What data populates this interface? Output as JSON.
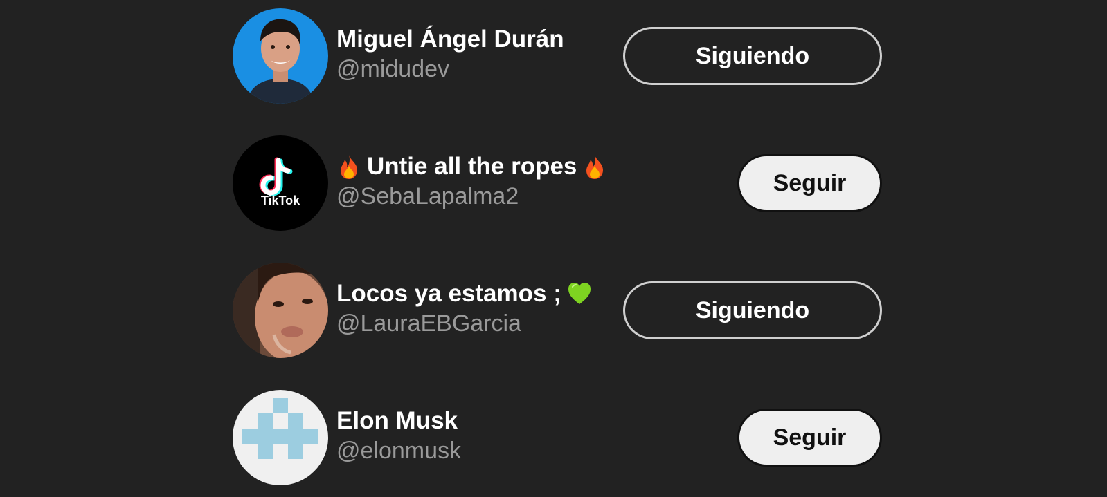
{
  "users": [
    {
      "name": "Miguel Ángel Durán",
      "handle": "@midudev",
      "button": "Siguiendo",
      "following": true,
      "avatar_icon": "person-photo"
    },
    {
      "name_emoji_left": "🔥",
      "name": "Untie all the ropes",
      "name_emoji_right": "🔥",
      "handle": "@SebaLapalma2",
      "button": "Seguir",
      "following": false,
      "avatar_icon": "tiktok-logo",
      "avatar_text": "TikTok"
    },
    {
      "name": "Locos ya estamos ;",
      "name_emoji_right": "💚",
      "handle": "@LauraEBGarcia",
      "button": "Siguiendo",
      "following": true,
      "avatar_icon": "person-photo"
    },
    {
      "name": "Elon Musk",
      "handle": "@elonmusk",
      "button": "Seguir",
      "following": false,
      "avatar_icon": "default-identicon"
    }
  ],
  "colors": {
    "background": "#222222",
    "name_text": "#ffffff",
    "handle_text": "#9a9a9a",
    "follow_button_bg": "#efefef",
    "following_border": "#cfcfcf"
  }
}
